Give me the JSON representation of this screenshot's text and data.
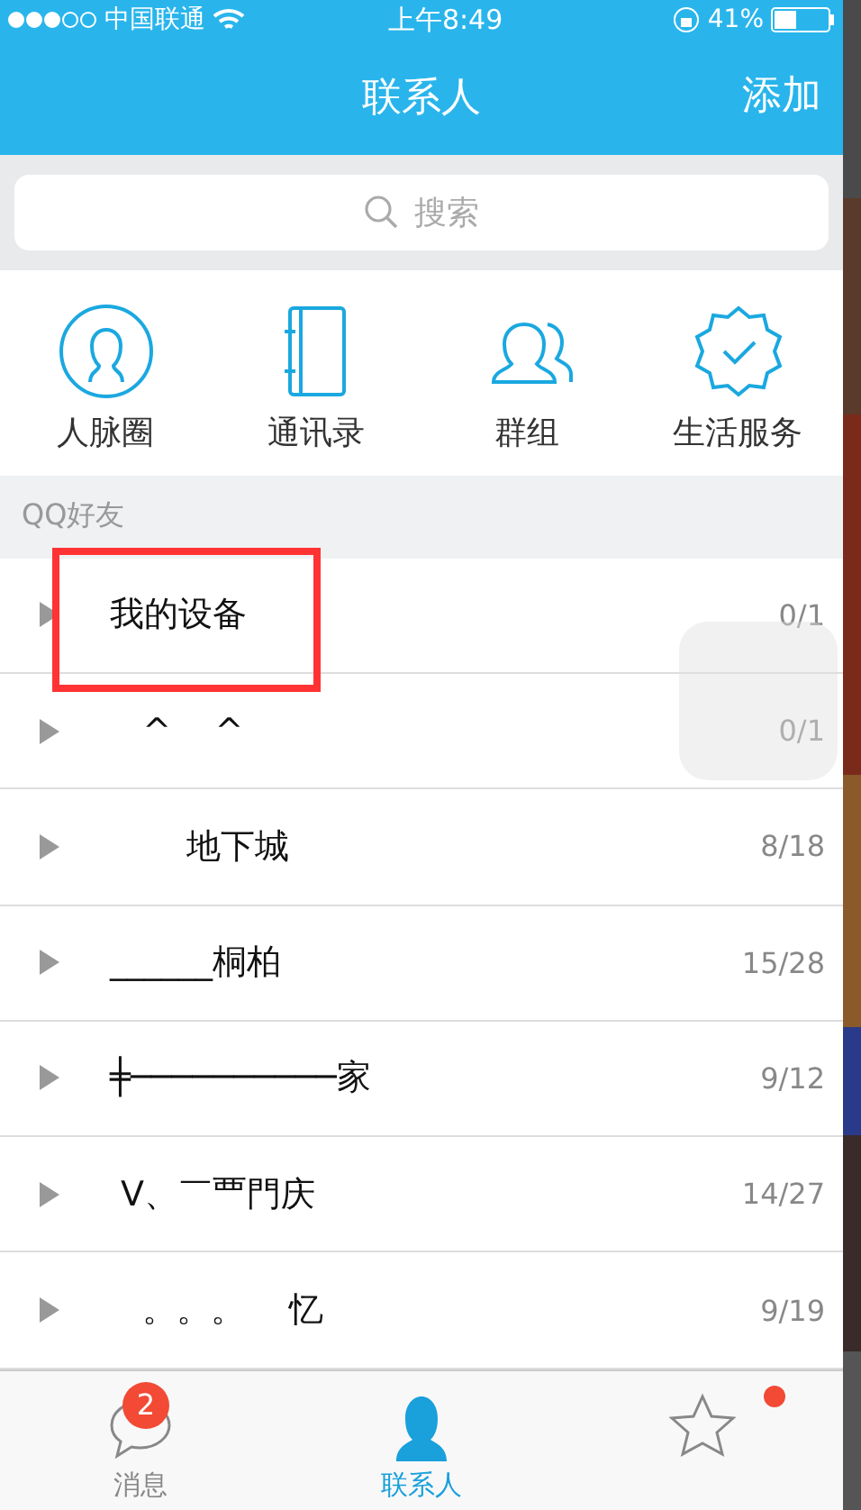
{
  "status_bar": {
    "carrier": "中国联通",
    "time": "上午8:49",
    "battery": "41%"
  },
  "nav": {
    "title": "联系人",
    "action": "添加"
  },
  "search": {
    "placeholder": "搜索"
  },
  "shortcuts": [
    {
      "kind": "circle-person",
      "label": "人脉圈"
    },
    {
      "kind": "book",
      "label": "通讯录"
    },
    {
      "kind": "people",
      "label": "群组"
    },
    {
      "kind": "badge",
      "label": "生活服务"
    }
  ],
  "section": "QQ好友",
  "groups": [
    {
      "name": "我的设备",
      "count": "0/1",
      "expanded": false,
      "highlighted": true
    },
    {
      "name": "   ^    ^",
      "count": "0/1",
      "expanded": false,
      "highlighted": false
    },
    {
      "name": "       地下城",
      "count": "8/18",
      "expanded": false,
      "highlighted": false
    },
    {
      "name": "______桐柏",
      "count": "15/28",
      "expanded": false,
      "highlighted": false
    },
    {
      "name": "╪──────────家",
      "count": "9/12",
      "expanded": false,
      "highlighted": false
    },
    {
      "name": " V、￣覀門庆",
      "count": "14/27",
      "expanded": false,
      "highlighted": false
    },
    {
      "name": "   。。。    忆",
      "count": "9/19",
      "expanded": false,
      "highlighted": false
    }
  ],
  "tabs": [
    {
      "kind": "chat",
      "label": "消息",
      "badge": "2",
      "selected": false
    },
    {
      "kind": "person",
      "label": "联系人",
      "selected": true
    },
    {
      "kind": "star",
      "dot": true,
      "selected": false
    }
  ]
}
